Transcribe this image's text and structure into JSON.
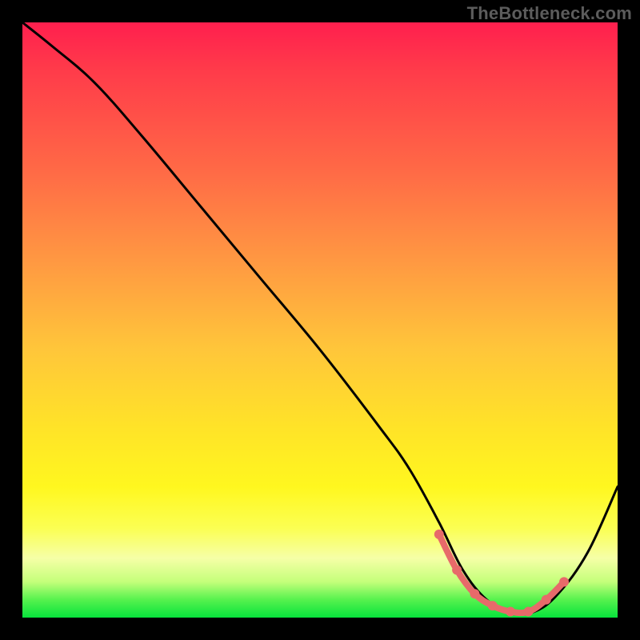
{
  "watermark": "TheBottleneck.com",
  "colors": {
    "background": "#000000",
    "curve": "#000000",
    "highlight": "#e76a6a",
    "gradient_top": "#ff1f4e",
    "gradient_bottom": "#07e33c"
  },
  "chart_data": {
    "type": "line",
    "title": "",
    "xlabel": "",
    "ylabel": "",
    "xlim": [
      0,
      100
    ],
    "ylim": [
      0,
      100
    ],
    "grid": false,
    "series": [
      {
        "name": "bottleneck-curve",
        "x": [
          0,
          5,
          12,
          20,
          30,
          40,
          50,
          60,
          65,
          70,
          74,
          78,
          82,
          86,
          90,
          95,
          100
        ],
        "y": [
          100,
          96,
          90,
          81,
          69,
          57,
          45,
          32,
          25,
          16,
          8,
          3,
          1,
          1,
          4,
          11,
          22
        ]
      }
    ],
    "highlight": {
      "name": "optimal-range",
      "x_range": [
        70,
        92
      ],
      "points_x": [
        70,
        73,
        76,
        79,
        82,
        85,
        88,
        91
      ],
      "points_y": [
        14,
        8,
        4,
        2,
        1,
        1,
        3,
        6
      ]
    },
    "gradient_stops": [
      {
        "pos": 0,
        "color": "#ff1f4e"
      },
      {
        "pos": 25,
        "color": "#ff6a46"
      },
      {
        "pos": 55,
        "color": "#ffc63a"
      },
      {
        "pos": 78,
        "color": "#fff71f"
      },
      {
        "pos": 90,
        "color": "#f6ffa7"
      },
      {
        "pos": 97,
        "color": "#56f24e"
      },
      {
        "pos": 100,
        "color": "#07e33c"
      }
    ]
  }
}
